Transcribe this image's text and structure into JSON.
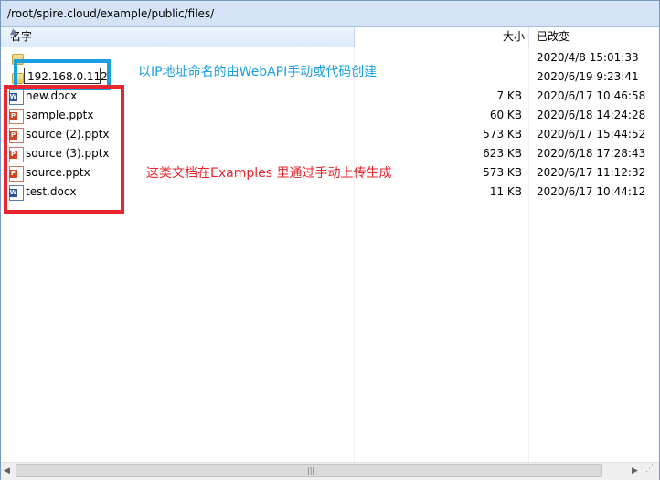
{
  "path": "/root/spire.cloud/example/public/files/",
  "columns": {
    "name": "名字",
    "size": "大小",
    "date": "已改变"
  },
  "rows": [
    {
      "name": "..",
      "size": "",
      "date": "2020/4/8 15:01:33",
      "icon": "folder-up-icon"
    },
    {
      "name": "192.168.0.112",
      "size": "",
      "date": "2020/6/19 9:23:41",
      "icon": "folder-icon"
    },
    {
      "name": "new.docx",
      "size": "7 KB",
      "date": "2020/6/17 10:46:58",
      "icon": "word-document-icon"
    },
    {
      "name": "sample.pptx",
      "size": "60 KB",
      "date": "2020/6/18 14:24:28",
      "icon": "powerpoint-document-icon"
    },
    {
      "name": "source (2).pptx",
      "size": "573 KB",
      "date": "2020/6/17 15:44:52",
      "icon": "powerpoint-document-icon"
    },
    {
      "name": "source (3).pptx",
      "size": "623 KB",
      "date": "2020/6/18 17:28:43",
      "icon": "powerpoint-document-icon"
    },
    {
      "name": "source.pptx",
      "size": "573 KB",
      "date": "2020/6/17 11:12:32",
      "icon": "powerpoint-document-icon"
    },
    {
      "name": "test.docx",
      "size": "11 KB",
      "date": "2020/6/17 10:44:12",
      "icon": "word-document-icon"
    }
  ],
  "annotations": {
    "blue_note": "以IP地址命名的由WebAPI手动或代码创建",
    "red_note": "这类文档在Examples 里通过手动上传生成"
  },
  "colors": {
    "annotation_blue": "#1aa0e0",
    "annotation_red": "#e8262d",
    "path_bar": "#d4e3f6"
  }
}
